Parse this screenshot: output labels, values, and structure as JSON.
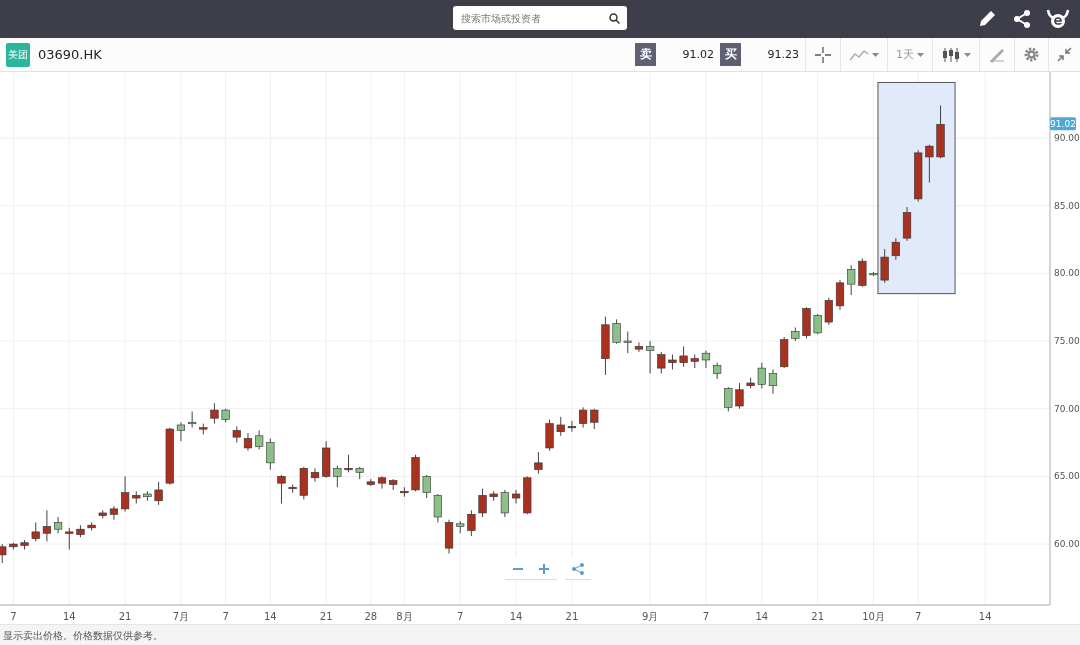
{
  "header": {
    "search": {
      "placeholder": "搜索市场或投资者"
    }
  },
  "instrument": {
    "logo_text": "美团",
    "symbol": "03690.HK",
    "sell": {
      "label": "卖",
      "price": "91.02"
    },
    "buy": {
      "label": "买",
      "price": "91.23"
    },
    "interval": "1天"
  },
  "chart": {
    "last_price_label": "91.02",
    "chart_data": {
      "type": "candlestick",
      "grid": true,
      "categories": [
        null,
        "7",
        null,
        null,
        null,
        null,
        "14",
        null,
        null,
        null,
        null,
        "21",
        null,
        null,
        null,
        null,
        "7月",
        null,
        null,
        null,
        "7",
        null,
        null,
        null,
        "14",
        null,
        null,
        null,
        null,
        "21",
        null,
        null,
        null,
        "28",
        null,
        null,
        "8月",
        null,
        null,
        null,
        null,
        "7",
        null,
        null,
        null,
        null,
        "14",
        null,
        null,
        null,
        null,
        "21",
        null,
        null,
        null,
        null,
        null,
        null,
        "9月",
        null,
        null,
        null,
        null,
        "7",
        null,
        null,
        null,
        null,
        "14",
        null,
        null,
        null,
        null,
        "21",
        null,
        null,
        null,
        null,
        "10月",
        null,
        null,
        null,
        "7",
        null,
        null,
        null,
        null,
        null,
        "14",
        null,
        null,
        null,
        null,
        null
      ],
      "ylim": [
        55.5,
        94.8
      ],
      "yticks": [
        {
          "value": 60,
          "label": "60.00"
        },
        {
          "value": 65,
          "label": "65.00"
        },
        {
          "value": 70,
          "label": "70.00"
        },
        {
          "value": 75,
          "label": "75.00"
        },
        {
          "value": 80,
          "label": "80.00"
        },
        {
          "value": 85,
          "label": "85.00"
        },
        {
          "value": 90,
          "label": "90.00"
        }
      ],
      "ohlc": [
        [
          59.2,
          60.0,
          58.6,
          59.8
        ],
        [
          59.8,
          60.1,
          59.6,
          60.0
        ],
        [
          59.9,
          60.3,
          59.6,
          60.1
        ],
        [
          60.4,
          61.6,
          60.2,
          60.9
        ],
        [
          60.8,
          62.5,
          60.2,
          61.3
        ],
        [
          61.6,
          62.0,
          60.8,
          61.1
        ],
        [
          60.8,
          61.2,
          59.6,
          60.9
        ],
        [
          60.7,
          61.4,
          60.5,
          61.1
        ],
        [
          61.2,
          61.6,
          61.0,
          61.4
        ],
        [
          62.1,
          62.5,
          61.9,
          62.3
        ],
        [
          62.2,
          62.8,
          61.8,
          62.6
        ],
        [
          62.6,
          65.0,
          62.4,
          63.8
        ],
        [
          63.4,
          63.9,
          63.0,
          63.6
        ],
        [
          63.7,
          63.9,
          63.2,
          63.5
        ],
        [
          63.2,
          64.6,
          62.9,
          64.0
        ],
        [
          64.5,
          68.6,
          64.4,
          68.5
        ],
        [
          68.8,
          69.0,
          67.6,
          68.4
        ],
        [
          69.0,
          69.8,
          68.6,
          68.9
        ],
        [
          68.5,
          68.9,
          68.1,
          68.6
        ],
        [
          69.3,
          70.4,
          68.9,
          69.9
        ],
        [
          69.9,
          70.0,
          69.0,
          69.2
        ],
        [
          67.9,
          68.7,
          67.5,
          68.4
        ],
        [
          67.1,
          68.2,
          66.9,
          67.8
        ],
        [
          68.0,
          68.4,
          67.0,
          67.2
        ],
        [
          67.5,
          67.8,
          65.5,
          66.0
        ],
        [
          64.5,
          65.1,
          63.0,
          65.0
        ],
        [
          64.1,
          64.4,
          63.8,
          64.2
        ],
        [
          63.6,
          65.7,
          63.3,
          65.6
        ],
        [
          64.9,
          65.6,
          64.6,
          65.3
        ],
        [
          65.0,
          67.6,
          64.9,
          67.1
        ],
        [
          65.6,
          65.8,
          64.2,
          65.0
        ],
        [
          65.5,
          66.6,
          65.3,
          65.6
        ],
        [
          65.6,
          65.7,
          64.8,
          65.3
        ],
        [
          64.4,
          64.8,
          64.3,
          64.6
        ],
        [
          64.5,
          65.0,
          64.1,
          64.9
        ],
        [
          64.4,
          64.8,
          64.0,
          64.7
        ],
        [
          63.8,
          64.2,
          63.5,
          63.9
        ],
        [
          64.0,
          66.6,
          63.9,
          66.4
        ],
        [
          65.0,
          65.1,
          63.4,
          63.8
        ],
        [
          63.6,
          63.7,
          61.6,
          62.0
        ],
        [
          59.7,
          61.8,
          59.3,
          61.6
        ],
        [
          61.5,
          61.7,
          60.8,
          61.3
        ],
        [
          61.0,
          62.5,
          60.6,
          62.2
        ],
        [
          62.3,
          64.1,
          62.0,
          63.6
        ],
        [
          63.5,
          63.9,
          63.2,
          63.7
        ],
        [
          63.8,
          64.0,
          62.0,
          62.3
        ],
        [
          63.4,
          64.0,
          63.0,
          63.7
        ],
        [
          62.3,
          65.0,
          62.2,
          64.9
        ],
        [
          65.5,
          66.8,
          65.2,
          66.0
        ],
        [
          67.1,
          69.2,
          66.9,
          68.9
        ],
        [
          68.3,
          69.4,
          68.0,
          68.8
        ],
        [
          68.6,
          69.1,
          68.3,
          68.7
        ],
        [
          68.9,
          70.1,
          68.6,
          69.9
        ],
        [
          69.0,
          70.0,
          68.5,
          69.9
        ],
        [
          73.7,
          76.8,
          72.5,
          76.2
        ],
        [
          76.3,
          76.6,
          74.8,
          74.9
        ],
        [
          75.0,
          75.7,
          74.1,
          74.9
        ],
        [
          74.4,
          74.9,
          74.2,
          74.6
        ],
        [
          74.6,
          75.0,
          72.6,
          74.3
        ],
        [
          73.0,
          74.2,
          72.6,
          74.0
        ],
        [
          73.4,
          74.0,
          72.9,
          73.6
        ],
        [
          73.4,
          74.6,
          73.1,
          73.9
        ],
        [
          73.5,
          74.0,
          73.0,
          73.7
        ],
        [
          74.1,
          74.3,
          73.0,
          73.6
        ],
        [
          73.2,
          73.4,
          72.2,
          72.6
        ],
        [
          71.5,
          71.6,
          69.8,
          70.1
        ],
        [
          70.2,
          71.9,
          70.0,
          71.4
        ],
        [
          71.7,
          72.3,
          71.5,
          71.9
        ],
        [
          73.0,
          73.4,
          71.5,
          71.8
        ],
        [
          72.6,
          72.9,
          71.1,
          71.7
        ],
        [
          73.1,
          75.3,
          73.0,
          75.1
        ],
        [
          75.7,
          76.0,
          75.0,
          75.2
        ],
        [
          75.4,
          77.5,
          75.2,
          77.4
        ],
        [
          76.9,
          77.0,
          75.5,
          75.6
        ],
        [
          76.4,
          78.2,
          76.2,
          78.0
        ],
        [
          77.6,
          79.5,
          77.3,
          79.3
        ],
        [
          80.3,
          80.6,
          78.4,
          79.2
        ],
        [
          79.1,
          81.1,
          79.0,
          80.9
        ],
        [
          80.0,
          80.1,
          79.8,
          79.9
        ],
        [
          79.5,
          81.8,
          79.3,
          81.2
        ],
        [
          81.3,
          82.6,
          81.0,
          82.3
        ],
        [
          82.6,
          84.9,
          82.4,
          84.5
        ],
        [
          85.5,
          89.1,
          85.3,
          88.9
        ],
        [
          88.6,
          89.5,
          86.7,
          89.4
        ],
        [
          88.6,
          92.4,
          88.5,
          91.0
        ],
        null,
        null,
        null,
        null,
        null,
        null,
        null,
        null,
        null
      ]
    }
  },
  "footer": {
    "note": "显示卖出价格。价格数据仅供参考。"
  }
}
